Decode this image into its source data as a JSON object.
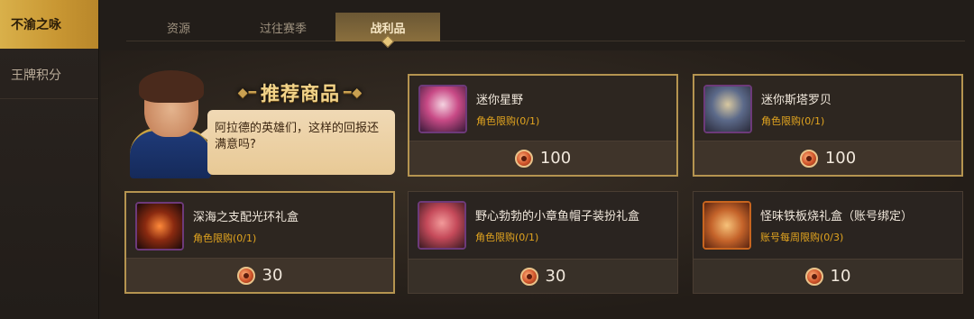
{
  "sidebar": {
    "items": [
      {
        "label": "不渝之咏",
        "active": true
      },
      {
        "label": "王牌积分",
        "active": false
      }
    ]
  },
  "tabs": [
    {
      "label": "资源",
      "active": false
    },
    {
      "label": "过往赛季",
      "active": false
    },
    {
      "label": "战利品",
      "active": true
    }
  ],
  "recommend": {
    "title": "推荐商品",
    "speech": "阿拉德的英雄们，这样的回报还满意吗?"
  },
  "products": [
    {
      "name": "迷你星野",
      "limit": "角色限购(0/1)",
      "price": "100",
      "icon": "mini-hoshino-avatar-icon"
    },
    {
      "name": "迷你斯塔罗贝",
      "limit": "角色限购(0/1)",
      "price": "100",
      "icon": "mini-starobe-avatar-icon"
    },
    {
      "name": "深海之支配光环礼盒",
      "limit": "角色限购(0/1)",
      "price": "30",
      "icon": "deep-sea-aura-icon"
    },
    {
      "name": "野心勃勃的小章鱼帽子装扮礼盒",
      "limit": "角色限购(0/1)",
      "price": "30",
      "icon": "octopus-hat-icon"
    },
    {
      "name": "怪味铁板烧礼盒（账号绑定）",
      "limit": "账号每周限购(0/3)",
      "price": "10",
      "icon": "teppanyaki-box-icon"
    }
  ],
  "colors": {
    "accent_gold": "#d9b04a",
    "limit_orange": "#e3a51f",
    "background": "#221d19"
  }
}
